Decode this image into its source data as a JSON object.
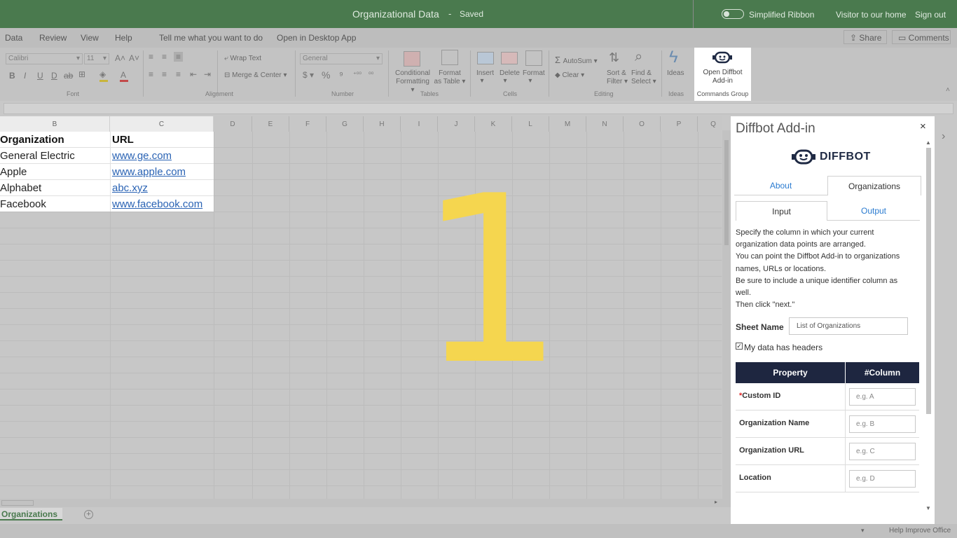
{
  "titlebar": {
    "doc_title": "Organizational Data",
    "separator": "-",
    "status": "Saved",
    "simplified_ribbon": "Simplified Ribbon",
    "visitor": "Visitor to our home",
    "sign_out": "Sign out"
  },
  "tabs": [
    "Data",
    "Review",
    "View",
    "Help",
    "Tell me what you want to do",
    "Open in Desktop App"
  ],
  "share": "Share",
  "comments": "Comments",
  "ribbon": {
    "font_name": "Calibri",
    "font_size": "11",
    "number_format": "General",
    "wrap_text": "Wrap Text",
    "merge_center": "Merge & Center",
    "conditional_formatting": [
      "Conditional",
      "Formatting"
    ],
    "format_as_table": [
      "Format",
      "as Table"
    ],
    "insert": "Insert",
    "delete": "Delete",
    "format": "Format",
    "autosum": "AutoSum",
    "clear": "Clear",
    "sort_filter": [
      "Sort &",
      "Filter"
    ],
    "find_select": [
      "Find &",
      "Select"
    ],
    "ideas": "Ideas",
    "open_diffbot": [
      "Open Diffbot",
      "Add-in"
    ],
    "groups": {
      "font": "Font",
      "alignment": "Alignment",
      "number": "Number",
      "tables": "Tables",
      "cells": "Cells",
      "editing": "Editing",
      "ideas": "Ideas",
      "commands": "Commands Group"
    }
  },
  "grid": {
    "columns": [
      "B",
      "C",
      "D",
      "E",
      "F",
      "G",
      "H",
      "I",
      "J",
      "K",
      "L",
      "M",
      "N",
      "O",
      "P",
      "Q"
    ],
    "headers": [
      "Organization",
      "URL"
    ],
    "rows": [
      {
        "org": "General Electric",
        "url": "www.ge.com"
      },
      {
        "org": "Apple",
        "url": "www.apple.com"
      },
      {
        "org": "Alphabet",
        "url": "abc.xyz"
      },
      {
        "org": "Facebook",
        "url": "www.facebook.com"
      }
    ]
  },
  "overlay_number": "1",
  "sheet_tab": "Organizations",
  "status_bar": {
    "help": "Help Improve Office"
  },
  "pane": {
    "title": "Diffbot Add-in",
    "close": "×",
    "logo_text": "DIFFBOT",
    "tab_about": "About",
    "tab_organizations": "Organizations",
    "tab_input": "Input",
    "tab_output": "Output",
    "description": [
      "Specify the column in which your current",
      "organization data points are arranged.",
      "You can point the Diffbot Add-in to organizations",
      "names, URLs or locations.",
      "Be sure to include a unique identifier column as",
      "well.",
      "Then click \"next.\""
    ],
    "sheet_name_label": "Sheet Name",
    "sheet_name_value": "List of Organizations",
    "headers_checkbox": "My data has headers",
    "headers_checked": true,
    "table_headers": [
      "Property",
      "#Column"
    ],
    "table_rows": [
      {
        "label": "Custom ID",
        "required": true,
        "placeholder": "e.g. A"
      },
      {
        "label": "Organization Name",
        "required": false,
        "placeholder": "e.g. B"
      },
      {
        "label": "Organization URL",
        "required": false,
        "placeholder": "e.g. C"
      },
      {
        "label": "Location",
        "required": false,
        "placeholder": "e.g. D"
      }
    ]
  },
  "colors": {
    "titlebar": "#4a7a4e",
    "accent_yellow": "#f5d64f",
    "table_header": "#1e2640",
    "link": "#2a63b4"
  }
}
